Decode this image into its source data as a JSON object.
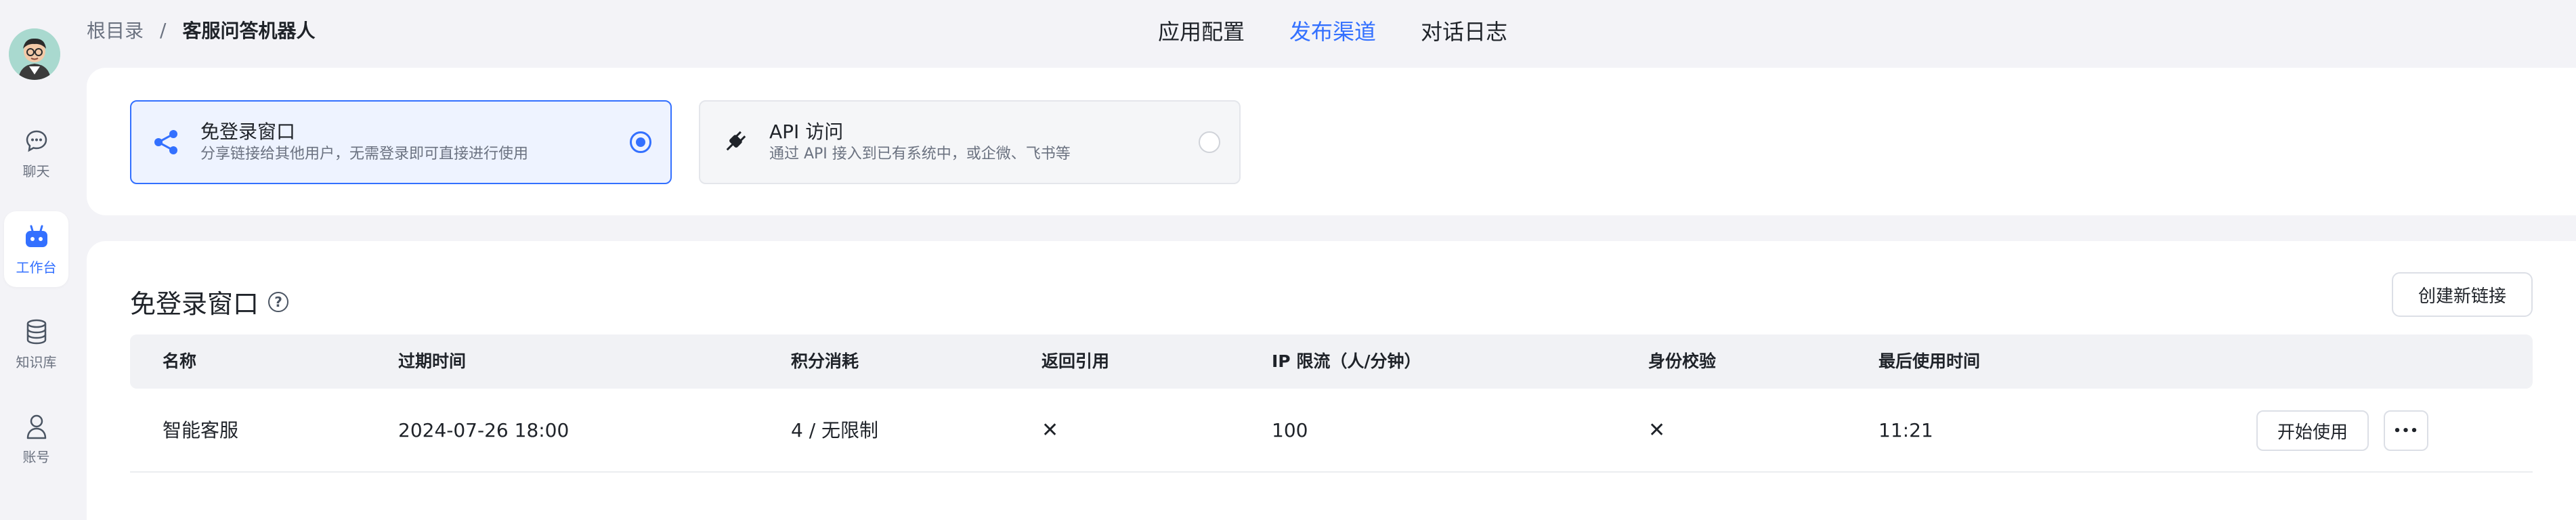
{
  "nav": {
    "items": [
      {
        "label": "聊天",
        "icon": "chat-icon",
        "active": false
      },
      {
        "label": "工作台",
        "icon": "robot-icon",
        "active": true
      },
      {
        "label": "知识库",
        "icon": "database-icon",
        "active": false
      },
      {
        "label": "账号",
        "icon": "user-icon",
        "active": false
      }
    ]
  },
  "breadcrumb": {
    "root": "根目录",
    "separator": "/",
    "current": "客服问答机器人"
  },
  "top_tabs": [
    {
      "label": "应用配置",
      "active": false
    },
    {
      "label": "发布渠道",
      "active": true
    },
    {
      "label": "对话日志",
      "active": false
    }
  ],
  "publish_options": [
    {
      "title": "免登录窗口",
      "desc": "分享链接给其他用户，无需登录即可直接进行使用",
      "icon": "share-icon",
      "selected": true
    },
    {
      "title": "API 访问",
      "desc": "通过 API 接入到已有系统中，或企微、飞书等",
      "icon": "plug-icon",
      "selected": false
    }
  ],
  "section": {
    "title": "免登录窗口",
    "help_icon": "?",
    "create_button": "创建新链接"
  },
  "table": {
    "headers": [
      "名称",
      "过期时间",
      "积分消耗",
      "返回引用",
      "IP 限流（人/分钟）",
      "身份校验",
      "最后使用时间"
    ],
    "rows": [
      {
        "name": "智能客服",
        "expire": "2024-07-26 18:00",
        "points": "4 / 无限制",
        "return_ref": "✕",
        "ip_limit": "100",
        "auth": "✕",
        "last_used": "11:21",
        "start_button": "开始使用",
        "more_button": "•••"
      }
    ]
  },
  "colors": {
    "accent": "#3370ff",
    "background": "#f3f3f7",
    "text": "#1f2329",
    "muted": "#6b7280"
  }
}
